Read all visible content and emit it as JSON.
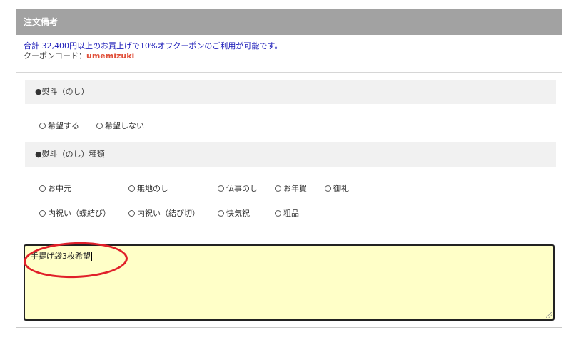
{
  "panel": {
    "title": "注文備考",
    "notice": {
      "line1": "合計 32,400円以上のお買上げで10%オフクーポンのご利用が可能です。",
      "line2_prefix": "クーポンコード：",
      "coupon_code": "umemizuki"
    }
  },
  "noshi": {
    "heading": "●熨斗（のし）",
    "options": [
      "希望する",
      "希望しない"
    ]
  },
  "noshi_type": {
    "heading": "●熨斗（のし）種類",
    "options_row1": [
      "お中元",
      "無地のし",
      "仏事のし",
      "お年賀",
      "御礼"
    ],
    "options_row2": [
      "内祝い（蝶結び）",
      "内祝い（結び切）",
      "快気祝",
      "粗品"
    ]
  },
  "remarks": {
    "value": "手提げ袋3枚希望"
  },
  "colors": {
    "header_bg": "#a2a2a2",
    "notice_blue": "#1a1ab8",
    "coupon_red": "#e0503a",
    "textarea_bg": "#ffffc8",
    "annotation_red": "#e0202a"
  }
}
